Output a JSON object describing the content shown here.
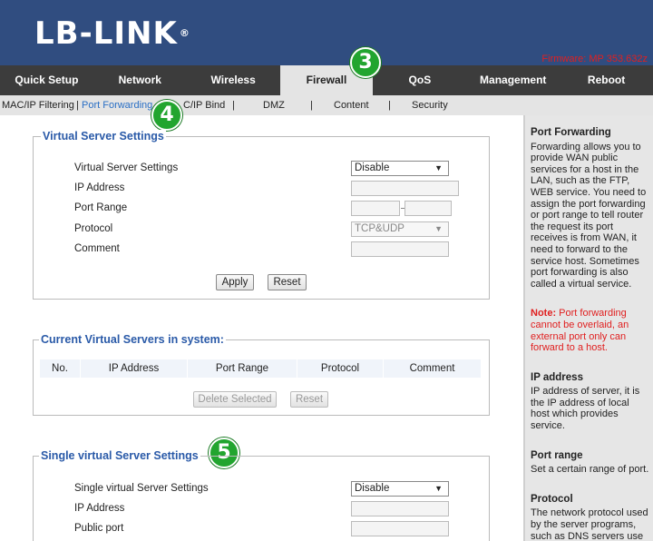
{
  "header": {
    "logo": "LB-LINK",
    "logo_mark": "®",
    "firmware": "Firmware: MP 353.632z"
  },
  "main_nav": [
    "Quick Setup",
    "Network",
    "Wireless",
    "Firewall",
    "QoS",
    "Management",
    "Reboot"
  ],
  "sub_nav": {
    "mac_ip_filtering": "MAC/IP Filtering",
    "port_forwarding": "Port Forwarding",
    "mac_ip_bind": "C/IP Bind",
    "dmz": "DMZ",
    "content": "Content",
    "security": "Security",
    "separator": "|"
  },
  "badges": {
    "b3": "3",
    "b4": "4",
    "b5": "5"
  },
  "virtual_server": {
    "legend": "Virtual Server Settings",
    "row_settings": "Virtual Server Settings",
    "row_ip": "IP Address",
    "row_port_range": "Port Range",
    "row_protocol": "Protocol",
    "row_comment": "Comment",
    "select_value": "Disable",
    "protocol_value": "TCP&UDP",
    "apply": "Apply",
    "reset": "Reset"
  },
  "current_servers": {
    "legend": "Current Virtual Servers in system:",
    "columns": [
      "No.",
      "IP Address",
      "Port Range",
      "Protocol",
      "Comment"
    ],
    "delete_selected": "Delete Selected",
    "reset": "Reset"
  },
  "single_server": {
    "legend": "Single virtual Server Settings",
    "row_settings": "Single virtual Server Settings",
    "row_ip": "IP Address",
    "row_public_port": "Public port",
    "select_value": "Disable"
  },
  "help": {
    "pf_title": "Port Forwarding",
    "pf_body": "Forwarding allows you to provide WAN public services for a host in the LAN, such as the FTP, WEB service. You need to assign the port forwarding or port range to tell router the request its port receives is from WAN, it need to forward to the service host. Sometimes port forwarding is also called a virtual service.",
    "note_label": "Note:",
    "note_body": " Port forwarding cannot be overlaid, an external port only can forward to a host.",
    "ip_title": "IP address",
    "ip_body": "IP address of server, it is the IP address of local host which provides service.",
    "range_title": "Port range",
    "range_body": "Set a certain range of port.",
    "proto_title": "Protocol",
    "proto_body": "The network protocol used by the server programs, such as DNS servers use UDP and WEB servers use"
  },
  "colors": {
    "header_bg": "#304d80",
    "nav_bg": "#3c3c3c",
    "legend": "#2a5aa8",
    "badge": "#22a52f",
    "alert": "#e02020"
  }
}
